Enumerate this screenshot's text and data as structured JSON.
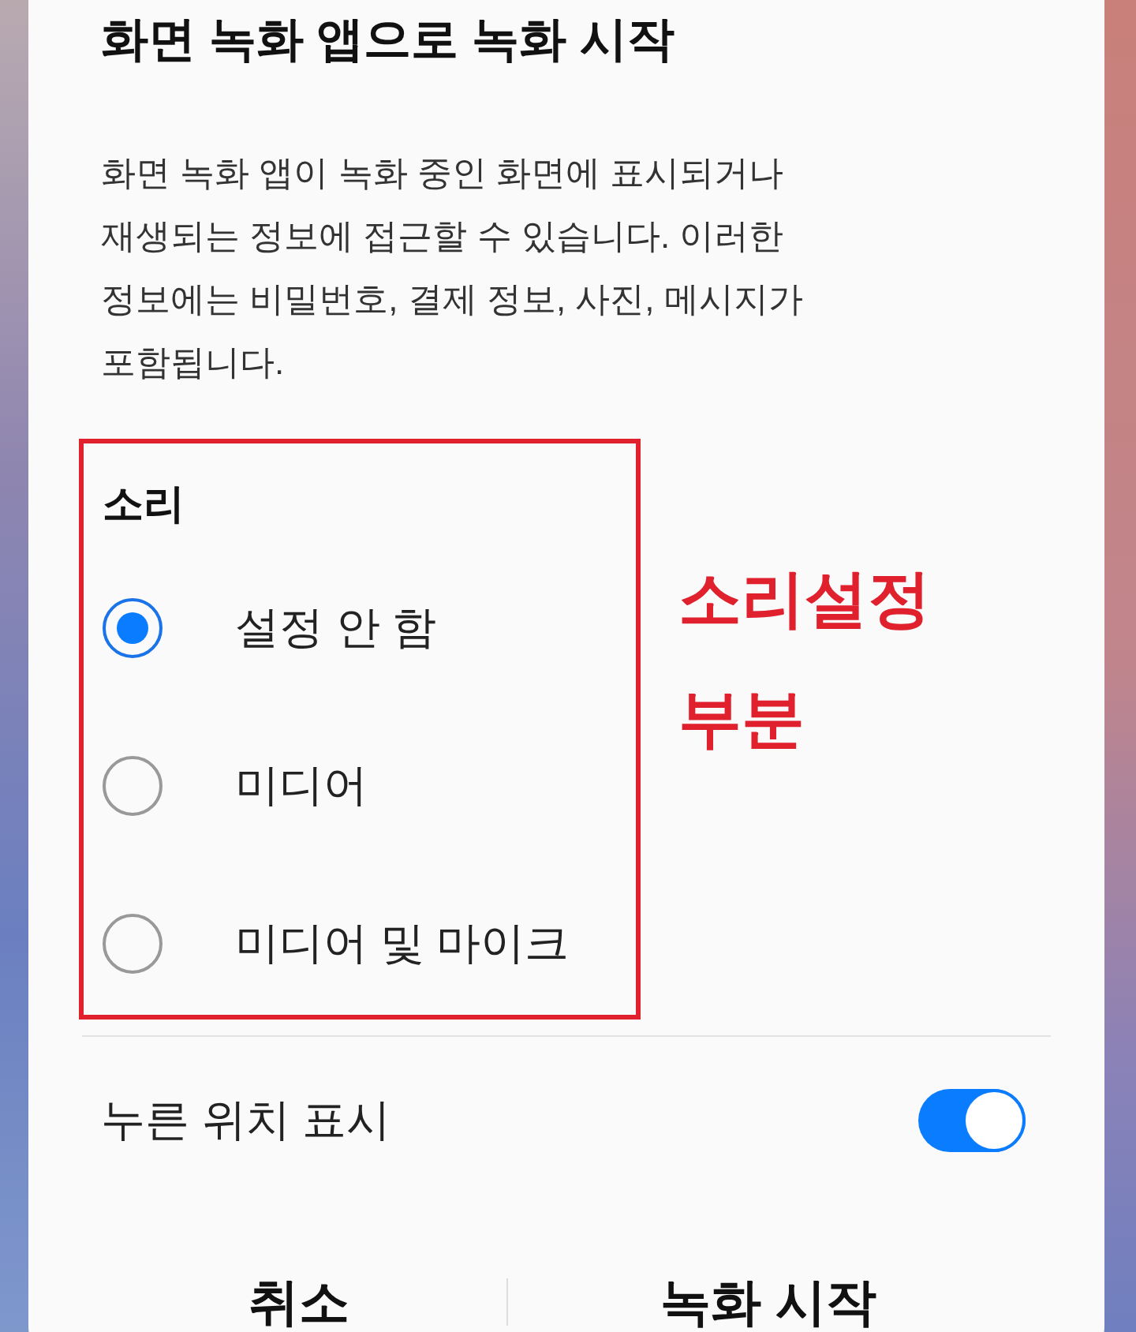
{
  "dialog": {
    "title": "화면 녹화 앱으로 녹화 시작",
    "description": "화면 녹화 앱이 녹화 중인 화면에 표시되거나 재생되는 정보에 접근할 수 있습니다. 이러한 정보에는 비밀번호, 결제 정보, 사진, 메시지가 포함됩니다.",
    "sound": {
      "heading": "소리",
      "options": [
        {
          "label": "설정 안 함",
          "selected": true
        },
        {
          "label": "미디어",
          "selected": false
        },
        {
          "label": "미디어 및 마이크",
          "selected": false
        }
      ]
    },
    "show_touches": {
      "label": "누른 위치 표시",
      "on": true
    },
    "buttons": [
      "취소",
      "녹화 시작"
    ]
  },
  "annotation": {
    "lines": [
      "소리설정",
      "부분"
    ]
  }
}
